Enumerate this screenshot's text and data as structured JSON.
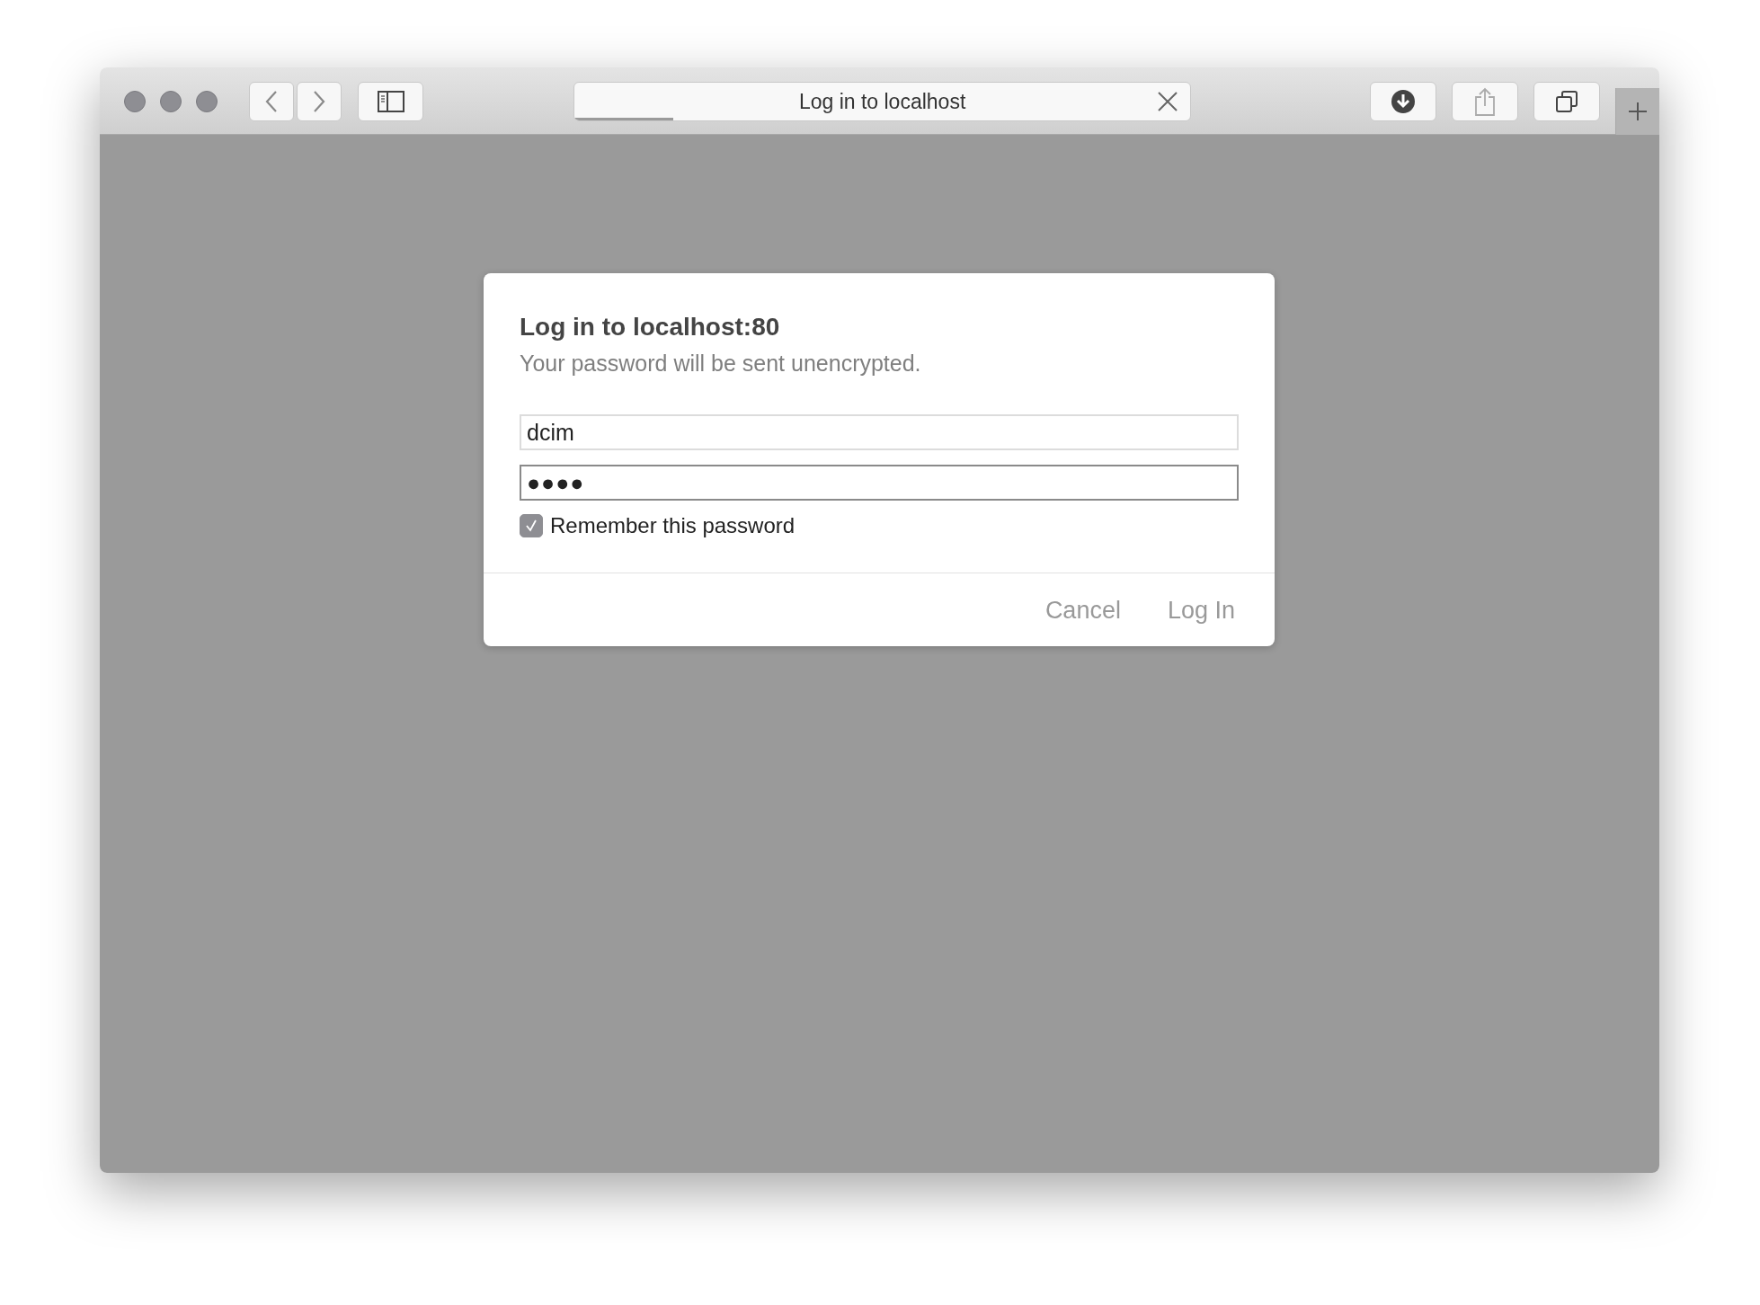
{
  "tab": {
    "title": "Log in to localhost",
    "level": 0.16
  },
  "dialog": {
    "title": "Log in to localhost:80",
    "message": "Your password will be sent unencrypted.",
    "username": {
      "value": "dcim"
    },
    "password": {
      "value": "●●●●",
      "focused": true
    },
    "remember": {
      "label": "Remember this password",
      "checked": true
    },
    "buttons": [
      {
        "label": "Cancel"
      },
      {
        "label": "Log In"
      }
    ]
  }
}
